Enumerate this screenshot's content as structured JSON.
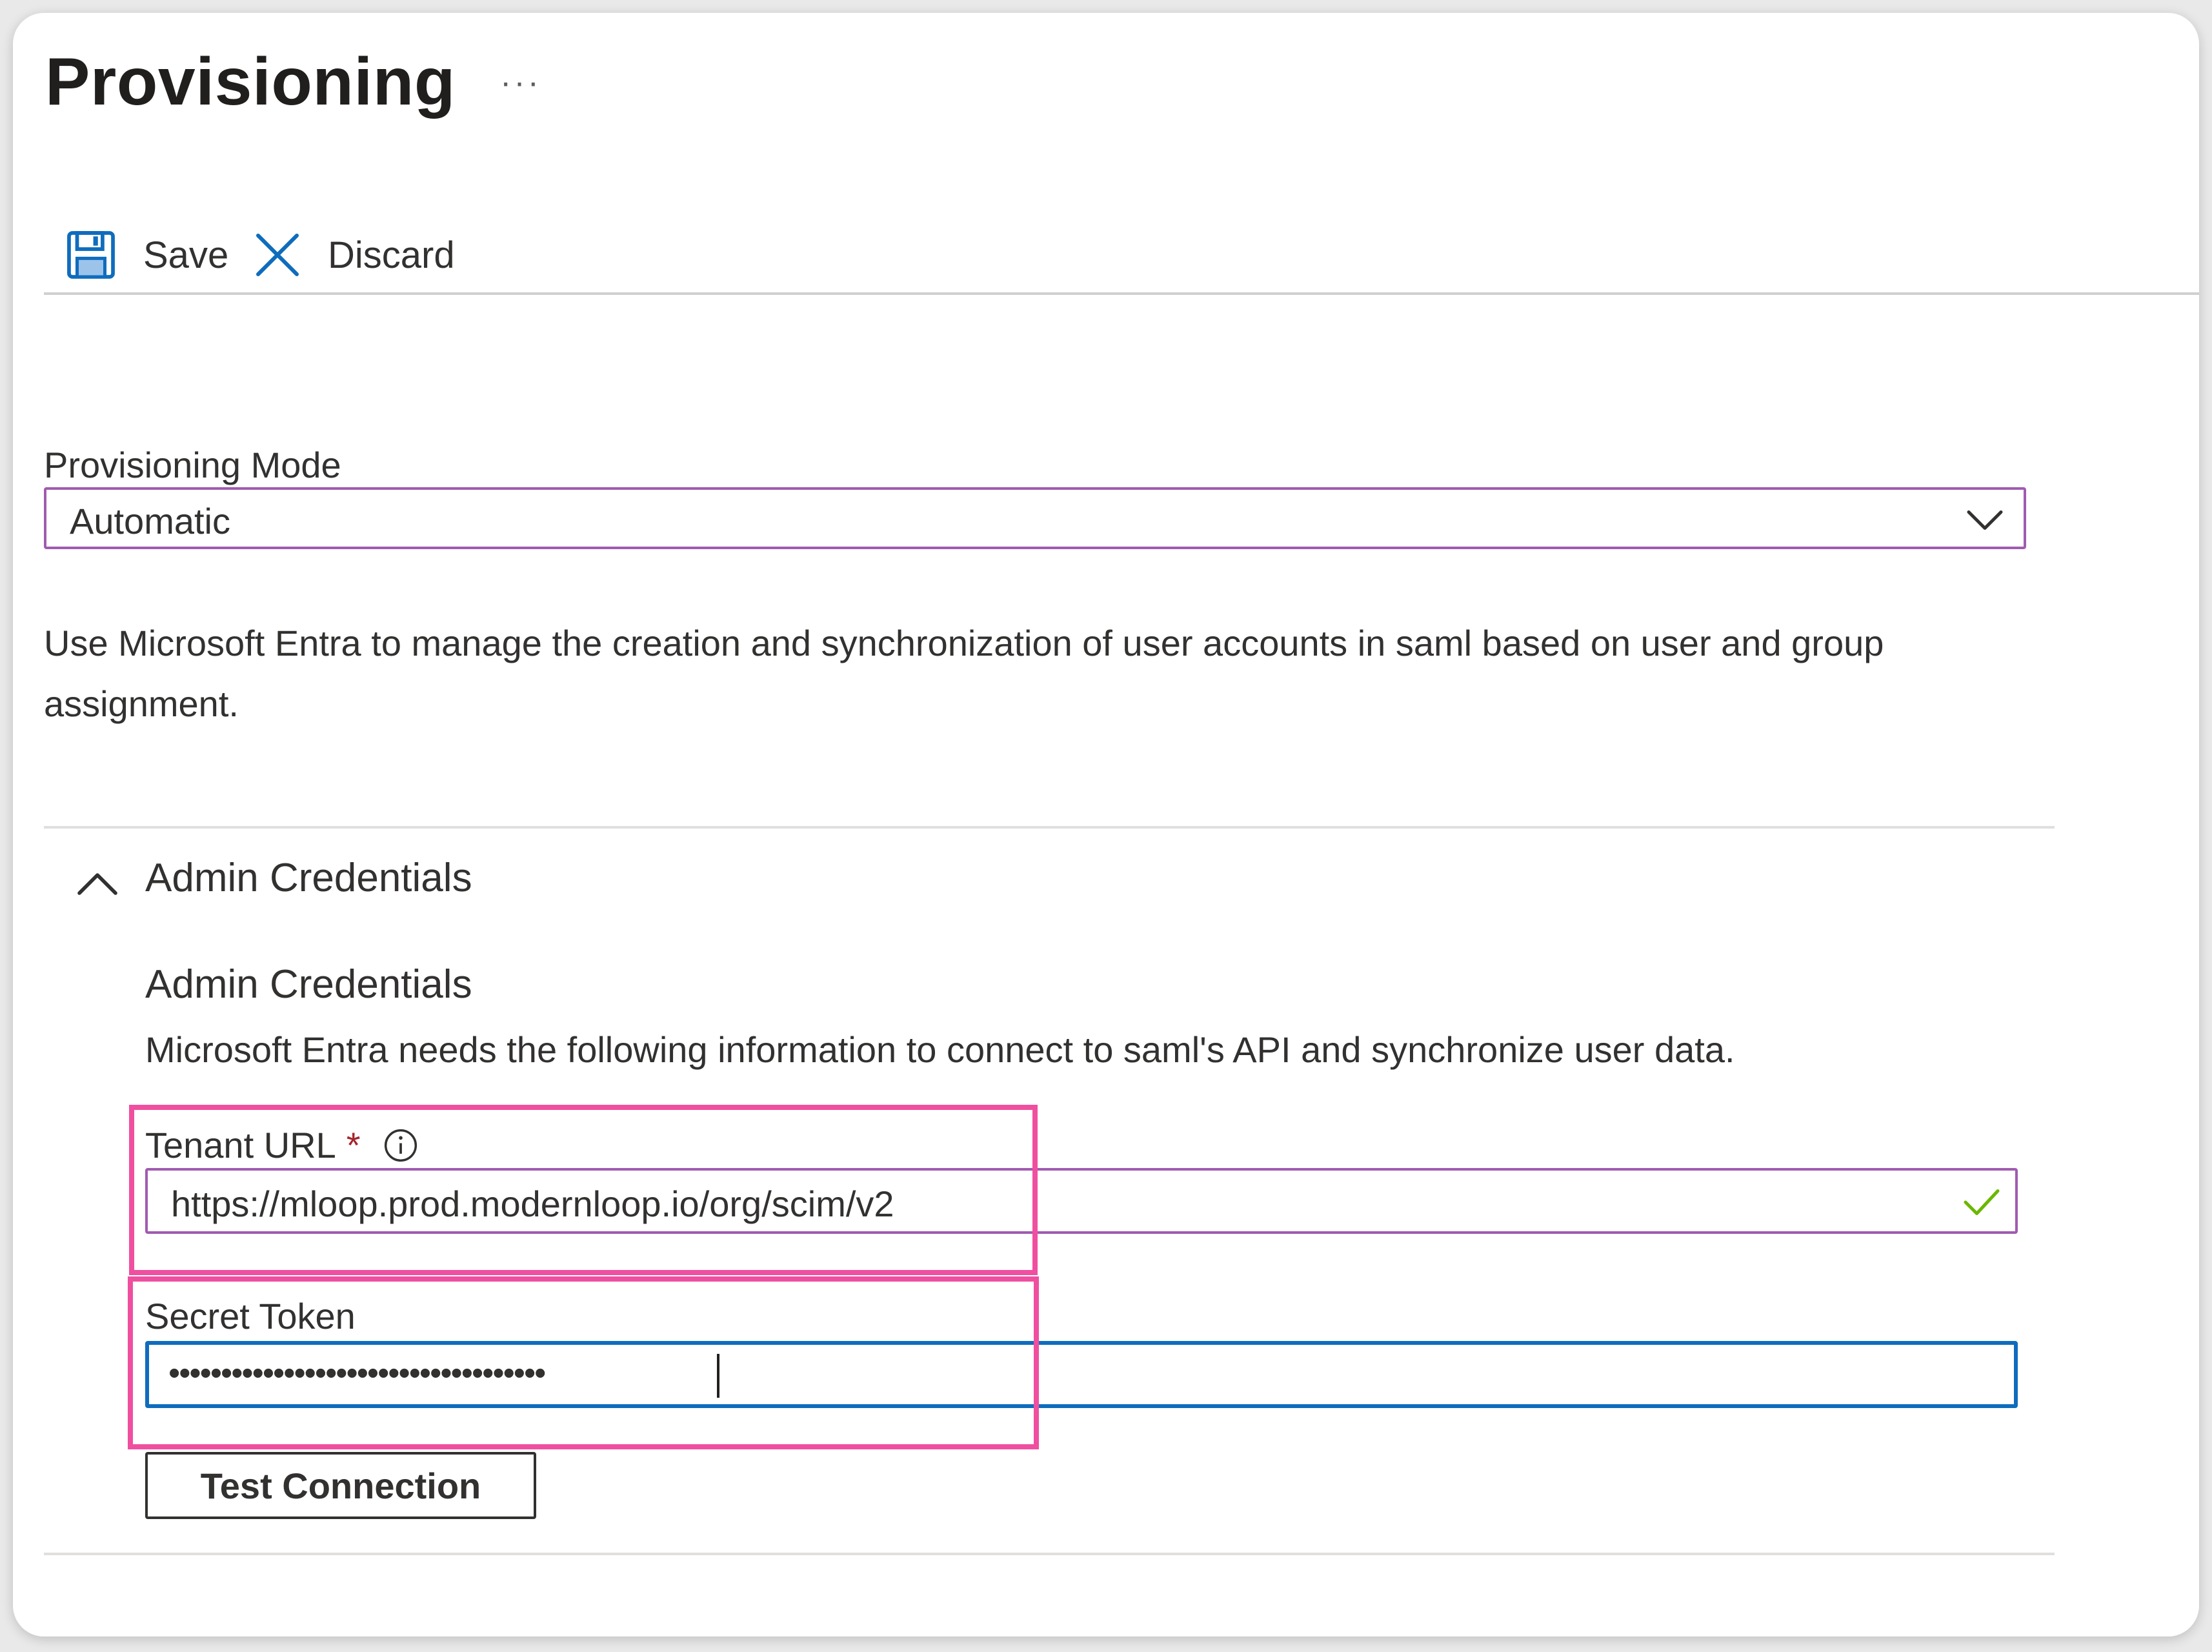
{
  "page": {
    "title": "Provisioning",
    "more_label": "···"
  },
  "toolbar": {
    "save_label": "Save",
    "discard_label": "Discard"
  },
  "provisioning_mode": {
    "label": "Provisioning Mode",
    "selected": "Automatic",
    "description": "Use Microsoft Entra to manage the creation and synchronization of user accounts in saml based on user and group assignment."
  },
  "admin_credentials": {
    "section_title": "Admin Credentials",
    "subtitle": "Admin Credentials",
    "description": "Microsoft Entra needs the following information to connect to saml's API and synchronize user data.",
    "tenant_url": {
      "label": "Tenant URL",
      "required_mark": "*",
      "value": "https://mloop.prod.modernloop.io/org/scim/v2"
    },
    "secret_token": {
      "label": "Secret Token",
      "masked_value": "••••••••••••••••••••••••••••••••••••"
    },
    "test_button_label": "Test Connection"
  },
  "colors": {
    "accent_blue": "#0f6cbd",
    "highlight_pink": "#f04fa0",
    "input_border_purple": "#a05bb0",
    "valid_green": "#6bb700",
    "required_red": "#a4262c"
  },
  "icons": {
    "save": "save-icon",
    "discard": "close-icon",
    "dropdown": "chevron-down-icon",
    "accordion": "chevron-up-icon",
    "info": "info-icon",
    "valid": "checkmark-icon"
  }
}
